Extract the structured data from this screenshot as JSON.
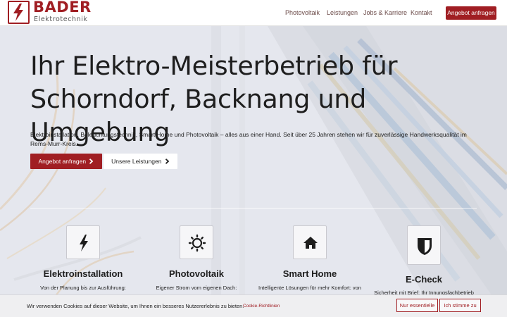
{
  "header": {
    "logo": {
      "brand": "BADER",
      "tagline": "Elektrotechnik"
    },
    "nav": [
      {
        "label": "Photovoltaik"
      },
      {
        "label": "Leistungen"
      },
      {
        "label": "Jobs & Karriere"
      },
      {
        "label": "Kontakt"
      }
    ],
    "cta_label": "Angebot anfragen"
  },
  "hero": {
    "title_line1": "Ihr Elektro-Meisterbetrieb für",
    "title_line2": "Schorndorf, Backnang und Umgebung",
    "subtitle": "Elektroinstallation, Beleuchtungstechnik, Smart Home und Photovoltaik – alles aus einer Hand. Seit über 25 Jahren stehen wir für zuverlässige Handwerksqualität im Rems-Murr-Kreis.",
    "primary_button": "Angebot anfragen",
    "secondary_button": "Unsere Leistungen",
    "button_icon": "chevron-right-icon"
  },
  "features": [
    {
      "icon": "lightning-bolt-icon",
      "title": "Elektroinstallation",
      "text": "Von der Planung bis zur Ausführung:"
    },
    {
      "icon": "sun-icon",
      "title": "Photovoltaik",
      "text": "Eigener Strom vom eigenen Dach:"
    },
    {
      "icon": "home-icon",
      "title": "Smart Home",
      "text": "Intelligente Lösungen für mehr Komfort: von"
    },
    {
      "icon": "shield-icon",
      "title": "E-Check",
      "text": "Sicherheit mit Brief: Ihr Innungsfachbetrieb"
    }
  ],
  "cookie": {
    "text": "Wir verwenden Cookies auf dieser Website, um Ihnen ein besseres Nutzererlebnis zu bieten.",
    "link": "Cookie-Richtlinien",
    "essential_button": "Nur essentielle",
    "accept_button": "Ich stimme zu"
  },
  "colors": {
    "brand": "#a01e23",
    "background": "#d4d7df",
    "text": "#1e1e1e"
  }
}
